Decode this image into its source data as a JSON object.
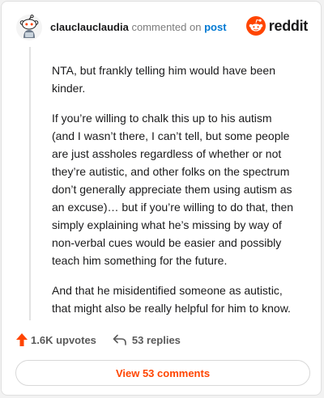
{
  "header": {
    "username": "clauclauclaudia",
    "action_text": "commented on",
    "post_link": "post",
    "brand_name": "reddit",
    "avatar_icon": "snoo-avatar-icon",
    "brand_icon": "reddit-alien-icon"
  },
  "comment": {
    "paragraphs": [
      "NTA, but frankly telling him would have been kinder.",
      "If you’re willing to chalk this up to his autism (and I wasn’t there, I can’t tell, but some people are just assholes regardless of whether or not they’re autistic, and other folks on the spectrum don’t generally appreciate them using autism as an excuse)… but if you’re willing to do that, then simply explaining what he’s missing by way of non-verbal cues would be easier and possibly teach him something for the future.",
      "And that he misidentified someone as autistic, that might also be really helpful for him to know."
    ]
  },
  "actions": {
    "upvotes": "1.6K upvotes",
    "replies": "53 replies",
    "upvote_icon": "upvote-arrow-icon",
    "reply_icon": "reply-arrow-icon"
  },
  "view_comments": "View 53 comments",
  "colors": {
    "brand_orange": "#ff4500",
    "link_blue": "#0079d3",
    "text_dark": "#1a1a1b",
    "text_muted": "#7c7c7c"
  }
}
